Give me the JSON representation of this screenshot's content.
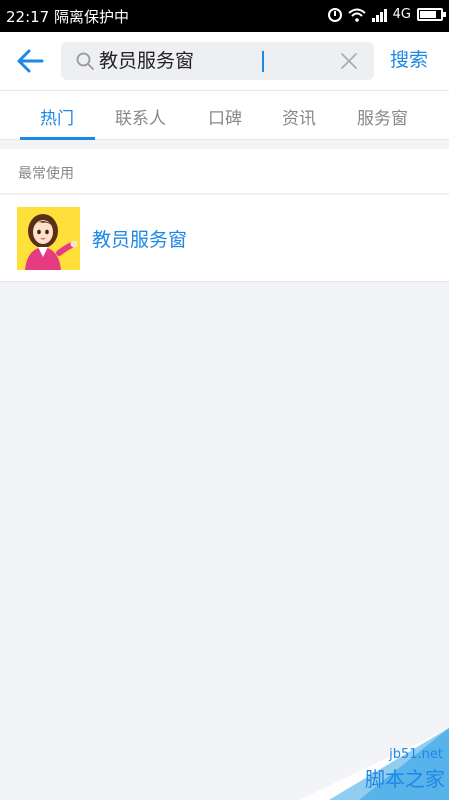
{
  "status_bar": {
    "time": "22:17",
    "mode": "隔离保护中",
    "network": "4G"
  },
  "search": {
    "value": "教员服务窗",
    "button_label": "搜索"
  },
  "tabs": [
    {
      "label": "热门",
      "active": true
    },
    {
      "label": "联系人",
      "active": false
    },
    {
      "label": "口碑",
      "active": false
    },
    {
      "label": "资讯",
      "active": false
    },
    {
      "label": "服务窗",
      "active": false
    }
  ],
  "section": {
    "title": "最常使用",
    "items": [
      {
        "label": "教员服务窗"
      }
    ]
  },
  "watermark": {
    "url": "jb51.net",
    "text": "脚本之家"
  },
  "colors": {
    "accent": "#1e88e5",
    "background": "#f3f4f8",
    "status_bar": "#000000"
  }
}
